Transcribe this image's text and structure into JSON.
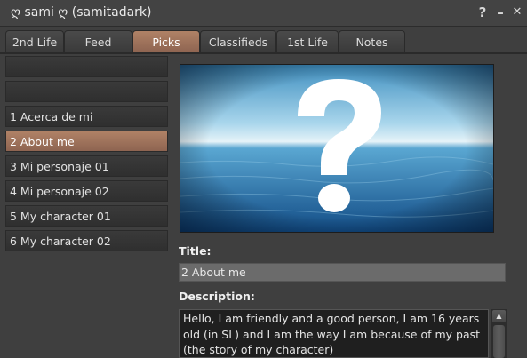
{
  "window": {
    "title": "ღ sami ღ (samitadark)",
    "help_label": "?",
    "minimize_label": "–",
    "close_label": "✕"
  },
  "tabs": [
    {
      "label": "2nd Life",
      "active": false
    },
    {
      "label": "Feed",
      "active": false
    },
    {
      "label": "Picks",
      "active": true
    },
    {
      "label": "Classifieds",
      "active": false
    },
    {
      "label": "1st Life",
      "active": false
    },
    {
      "label": "Notes",
      "active": false
    }
  ],
  "picks": [
    {
      "label": "1 Acerca de mi",
      "selected": false
    },
    {
      "label": "2 About me",
      "selected": true
    },
    {
      "label": "3 Mi personaje 01",
      "selected": false
    },
    {
      "label": "4 Mi personaje 02",
      "selected": false
    },
    {
      "label": "5 My character 01",
      "selected": false
    },
    {
      "label": "6 My character 02",
      "selected": false
    }
  ],
  "detail": {
    "image_icon": "question-mark-placeholder",
    "title_label": "Title:",
    "title_value": "2 About me",
    "description_label": "Description:",
    "description_value": "Hello, I am friendly and a good person, I am 16 years old (in SL) and I am the way I am because of my past (the story of my character)"
  },
  "colors": {
    "accent": "#a07058",
    "background": "#3f3f3f"
  }
}
